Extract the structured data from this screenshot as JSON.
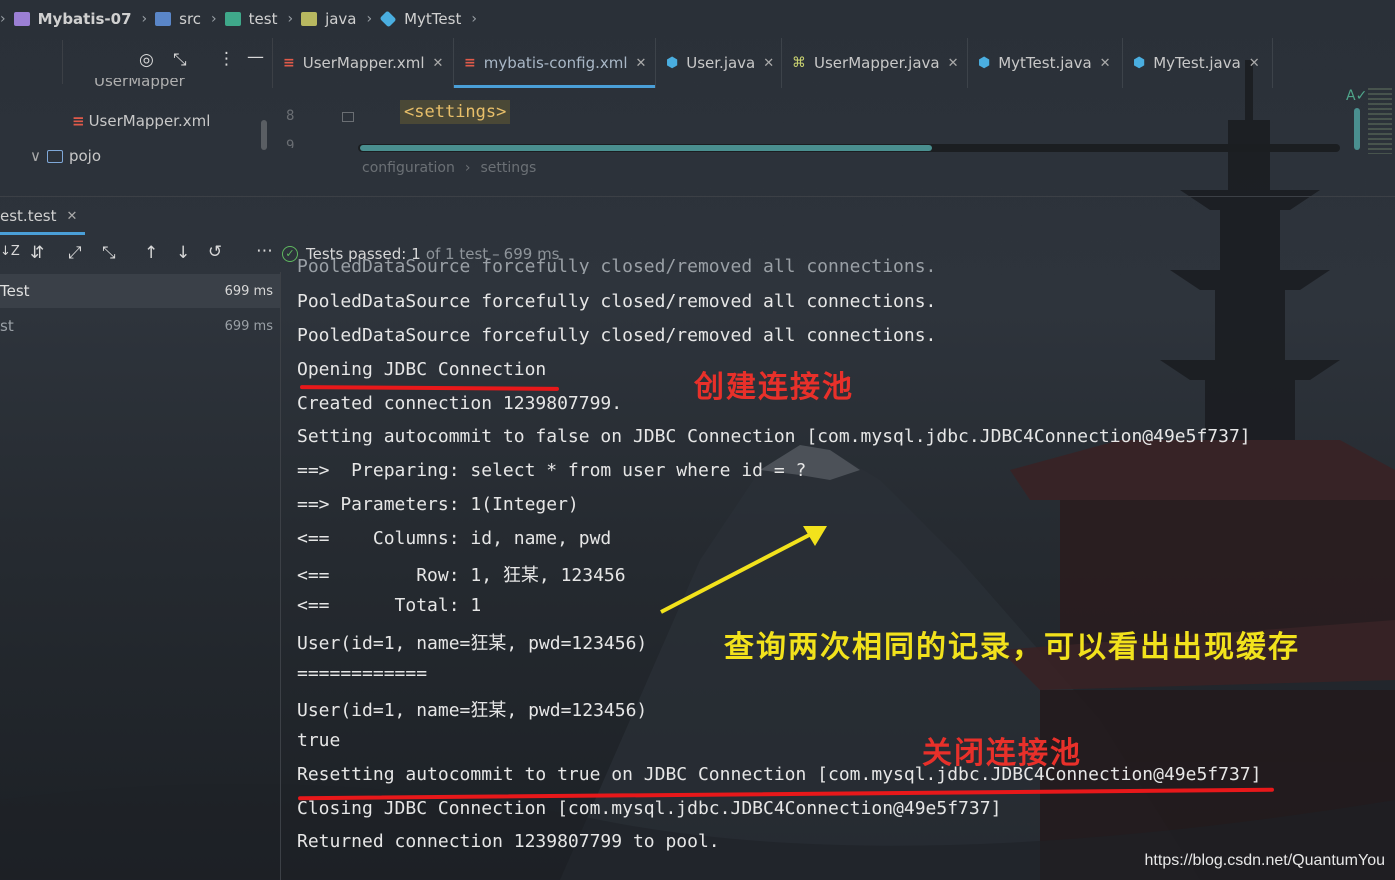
{
  "breadcrumb": {
    "project": "Mybatis-07",
    "items": [
      "src",
      "test",
      "java",
      "MytTest"
    ]
  },
  "project_tree": {
    "partial_item": "UserMapper",
    "file": "UserMapper.xml",
    "folder": "pojo"
  },
  "tabs": [
    {
      "label": "UserMapper.xml",
      "icon": "xml-file-icon"
    },
    {
      "label": "mybatis-config.xml",
      "icon": "xml-file-icon",
      "active": true
    },
    {
      "label": "User.java",
      "icon": "java-class-icon"
    },
    {
      "label": "UserMapper.java",
      "icon": "interface-icon"
    },
    {
      "label": "MytTest.java",
      "icon": "java-class-icon"
    },
    {
      "label": "MyTest.java",
      "icon": "java-class-icon"
    }
  ],
  "editor": {
    "line_numbers": [
      "8",
      "9"
    ],
    "code_tag": "settings",
    "breadcrumbs": [
      "configuration",
      "settings"
    ]
  },
  "run_panel": {
    "tab_label": "est.test",
    "status": {
      "passed_label": "Tests passed:",
      "passed_count": "1",
      "of_text": "of 1 test",
      "duration": "699 ms"
    },
    "tree": [
      {
        "label": "Test",
        "duration": "699 ms"
      },
      {
        "label": "st",
        "duration": "699 ms"
      }
    ]
  },
  "console_lines": [
    "PooledDataSource forcefully closed/removed all connections.",
    "PooledDataSource forcefully closed/removed all connections.",
    "PooledDataSource forcefully closed/removed all connections.",
    "Opening JDBC Connection",
    "Created connection 1239807799.",
    "Setting autocommit to false on JDBC Connection [com.mysql.jdbc.JDBC4Connection@49e5f737]",
    "==>  Preparing: select * from user where id = ?",
    "==> Parameters: 1(Integer)",
    "<==    Columns: id, name, pwd",
    "<==        Row: 1, 狂某, 123456",
    "<==      Total: 1",
    "User(id=1, name=狂某, pwd=123456)",
    "============",
    "User(id=1, name=狂某, pwd=123456)",
    "true",
    "Resetting autocommit to true on JDBC Connection [com.mysql.jdbc.JDBC4Connection@49e5f737]",
    "Closing JDBC Connection [com.mysql.jdbc.JDBC4Connection@49e5f737]",
    "Returned connection 1239807799 to pool."
  ],
  "annotations": {
    "create_pool": "创建连接池",
    "cache_note": "查询两次相同的记录，可以看出出现缓存",
    "close_pool": "关闭连接池"
  },
  "watermark": "https://blog.csdn.net/QuantumYou",
  "colors": {
    "accent_tab": "#4a9fd8",
    "annotation_red": "#e8302a",
    "annotation_yellow": "#f2e21c",
    "pass_green": "#5fb85f"
  }
}
